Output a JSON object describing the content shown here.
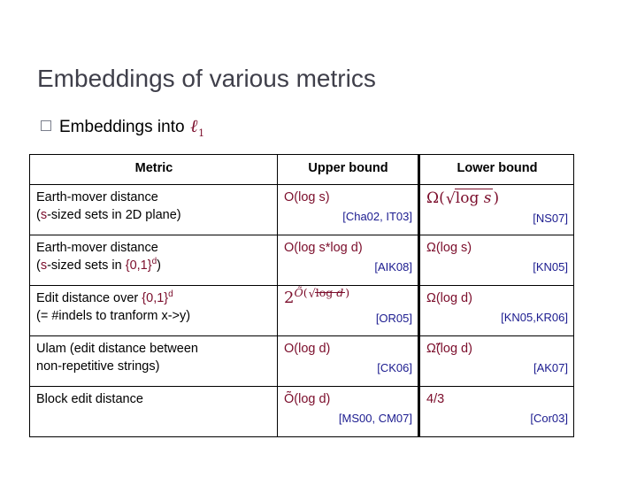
{
  "slide": {
    "title": "Embeddings of various metrics",
    "bullet": {
      "marker": "empty-square-bullet",
      "text": "Embeddings into",
      "ell": "ℓ",
      "ell_sub": "1"
    }
  },
  "colors": {
    "title": "#3f3f4a",
    "bullet_marker": "#7a7f8c",
    "formula": "#7b0d2b",
    "citation": "#1b1b8f",
    "border": "#000000",
    "background": "#ffffff"
  },
  "table": {
    "headers": [
      "Metric",
      "Upper bound",
      "Lower bound"
    ],
    "rows": [
      {
        "metric_line1": "Earth-mover distance",
        "metric_line2_pre": "(",
        "metric_line2_s": "s",
        "metric_line2_post": "-sized sets in 2D plane)",
        "upper_bound": "O(log s)",
        "upper_cite": "[Cha02, IT03]",
        "lower_bound": "Ω(√log s)",
        "lower_cite": "[NS07]"
      },
      {
        "metric_line1": "Earth-mover distance",
        "metric_line2_pre": "(",
        "metric_line2_s": "s",
        "metric_line2_post": "-sized sets in ",
        "metric_line2_set": "{0,1}",
        "metric_line2_sup": "d",
        "metric_line2_end": ")",
        "upper_bound": "O(log s*log d)",
        "upper_cite": "[AIK08]",
        "lower_bound": "Ω(log s)",
        "lower_cite": "[KN05]"
      },
      {
        "metric_line1_pre": "Edit distance over ",
        "metric_line1_set": "{0,1}",
        "metric_line1_sup": "d",
        "metric_line2": "(= #indels to tranform x->y)",
        "upper_bound": "2^Õ(√log d)",
        "upper_cite": "[OR05]",
        "lower_bound": "Ω(log d)",
        "lower_cite": "[KN05,KR06]"
      },
      {
        "metric_line1": "Ulam (edit distance between",
        "metric_line2": "non-repetitive strings)",
        "upper_bound": "O(log d)",
        "upper_cite": "[CK06]",
        "lower_bound": "Ω̃(log d)",
        "lower_cite": "[AK07]"
      },
      {
        "metric_line1": "Block edit distance",
        "metric_line2": "",
        "upper_bound": "Õ(log d)",
        "upper_cite": "[MS00, CM07]",
        "lower_bound": "4/3",
        "lower_cite": "[Cor03]"
      }
    ]
  }
}
